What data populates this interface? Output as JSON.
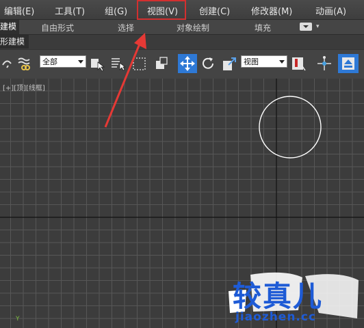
{
  "menu": {
    "items": [
      {
        "label": "编辑(E)"
      },
      {
        "label": "工具(T)"
      },
      {
        "label": "组(G)"
      },
      {
        "label": "视图(V)"
      },
      {
        "label": "创建(C)"
      },
      {
        "label": "修改器(M)"
      },
      {
        "label": "动画(A)"
      }
    ]
  },
  "ribbon": {
    "tabs": [
      {
        "label": "建模"
      },
      {
        "label": "自由形式"
      },
      {
        "label": "选择"
      },
      {
        "label": "对象绘制"
      },
      {
        "label": "填充"
      }
    ]
  },
  "panel_label": "形建模",
  "toolbar": {
    "selection_filter": "全部",
    "reference_coord": "视图"
  },
  "viewport": {
    "label_plus": "[+]",
    "label_view": "[顶]",
    "label_shading": "[线框]",
    "axis_label": "Y"
  },
  "watermark": {
    "title": "较真儿",
    "url": "jiaozhen.cc"
  },
  "colors": {
    "highlight_box": "#d32f2f",
    "arrow": "#e53935",
    "grid_line": "#575757",
    "axis_line": "#111111",
    "circle": "#ffffff",
    "watermark_blue": "#1e5bd6"
  }
}
